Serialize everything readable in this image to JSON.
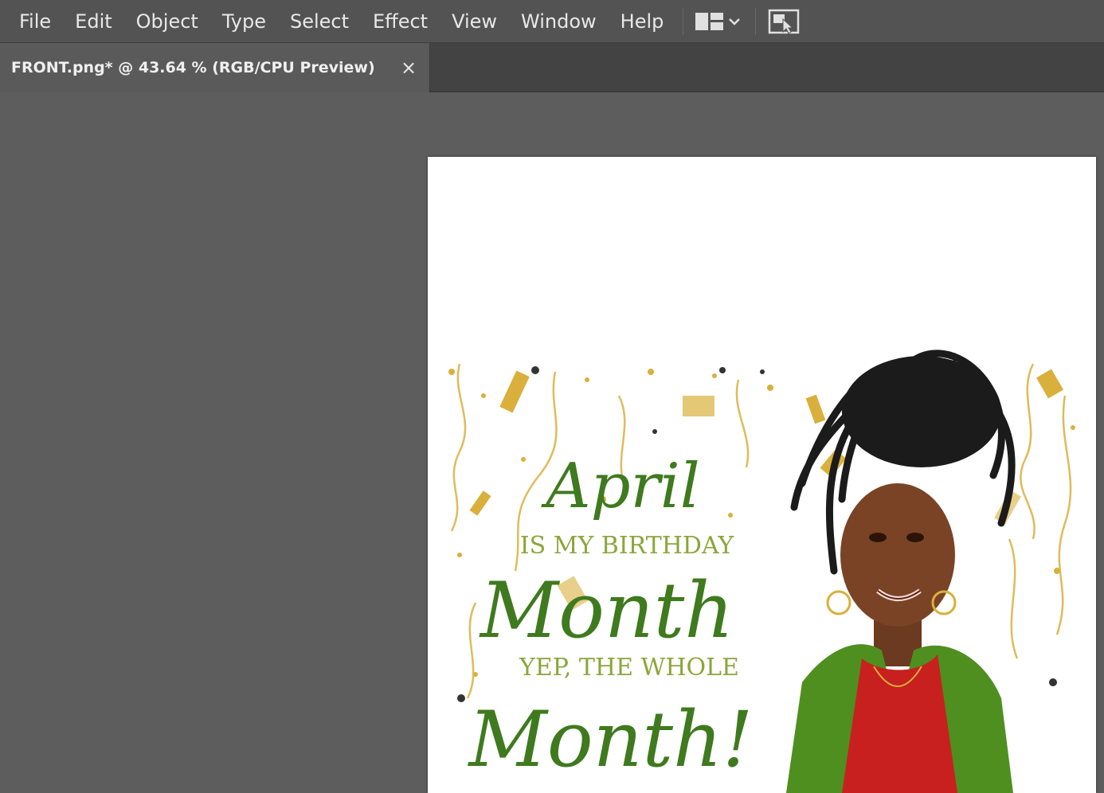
{
  "menubar": {
    "items": [
      "File",
      "Edit",
      "Object",
      "Type",
      "Select",
      "Effect",
      "View",
      "Window",
      "Help"
    ]
  },
  "toolbar": {
    "workspace_icon": "workspace-layout-icon",
    "dropdown_icon": "chevron-down-icon",
    "arrange_icon": "arrange-documents-icon"
  },
  "document_tab": {
    "title": "FRONT.png* @ 43.64 % (RGB/CPU Preview)",
    "close": "×"
  },
  "artwork": {
    "line1": "April",
    "line2": "IS MY BIRTHDAY",
    "line3": "Month",
    "line4": "YEP, THE WHOLE",
    "line5": "Month!",
    "colors": {
      "dark_green": "#3f7a1e",
      "light_green": "#8aa63a",
      "gold": "#d9b03c",
      "jacket": "#4f8f1f",
      "shirt": "#c8201e",
      "skin": "#7a4326",
      "hair": "#1b1b1b"
    }
  }
}
